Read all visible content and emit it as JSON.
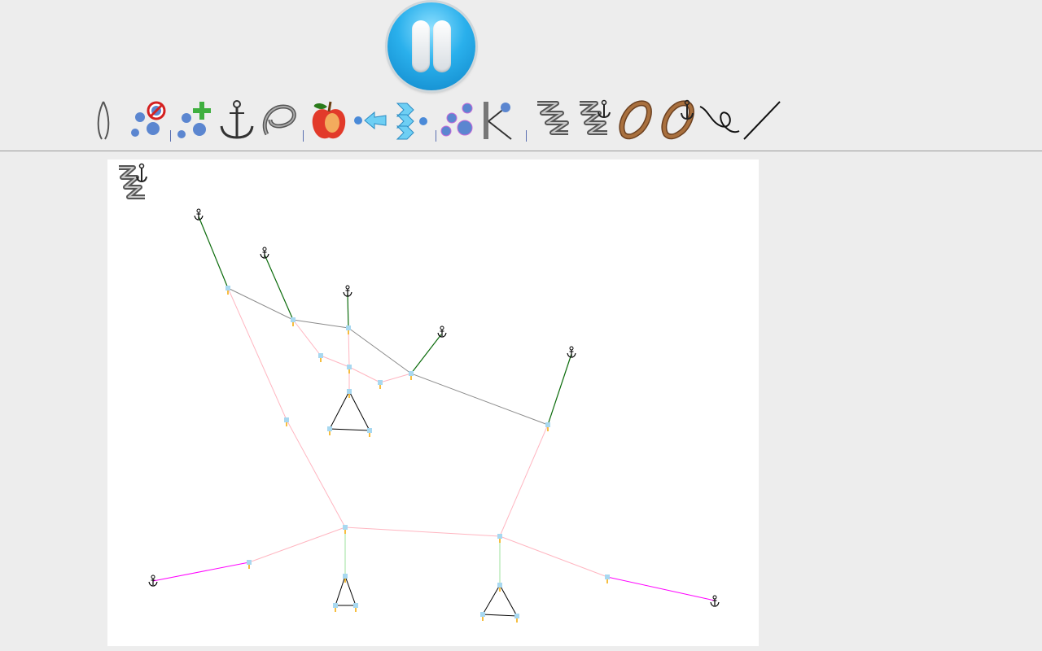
{
  "app": {
    "mode": "spring-anchor"
  },
  "colors": {
    "background": "#ededed",
    "canvas": "#ffffff",
    "pause_button": "#2ab0ec",
    "edge_gray": "#8a8a8a",
    "edge_pink": "#ffb6c1",
    "edge_green_dark": "#0b6b0b",
    "edge_green_light": "#9ee29e",
    "edge_magenta": "#ff00ff",
    "node_fill": "#a8d8f0",
    "node_leg": "#f2a900"
  },
  "toolbar": {
    "pause_icon": "pause-icon",
    "tools": [
      {
        "id": "wire",
        "icon": "wire-loop-icon"
      },
      {
        "id": "delete-nodes",
        "icon": "delete-nodes-icon"
      },
      {
        "id": "add-nodes",
        "icon": "add-nodes-icon"
      },
      {
        "id": "anchor",
        "icon": "anchor-icon"
      },
      {
        "id": "rope-loop",
        "icon": "rope-loop-icon"
      },
      {
        "id": "apple",
        "icon": "apple-icon"
      },
      {
        "id": "pull",
        "icon": "pull-arrow-icon"
      },
      {
        "id": "wind",
        "icon": "wind-arrows-icon"
      },
      {
        "id": "select-nodes",
        "icon": "select-nodes-icon"
      },
      {
        "id": "connect",
        "icon": "connect-nodes-icon"
      },
      {
        "id": "spring",
        "icon": "spring-icon"
      },
      {
        "id": "spring-anchor",
        "icon": "spring-anchor-icon"
      },
      {
        "id": "rubber-band",
        "icon": "rubber-band-icon"
      },
      {
        "id": "rubber-band-anchor",
        "icon": "rubber-band-anchor-icon"
      },
      {
        "id": "string",
        "icon": "string-icon"
      },
      {
        "id": "line",
        "icon": "line-icon"
      }
    ]
  },
  "canvas": {
    "tool_indicator_icon": "spring-anchor-icon"
  }
}
